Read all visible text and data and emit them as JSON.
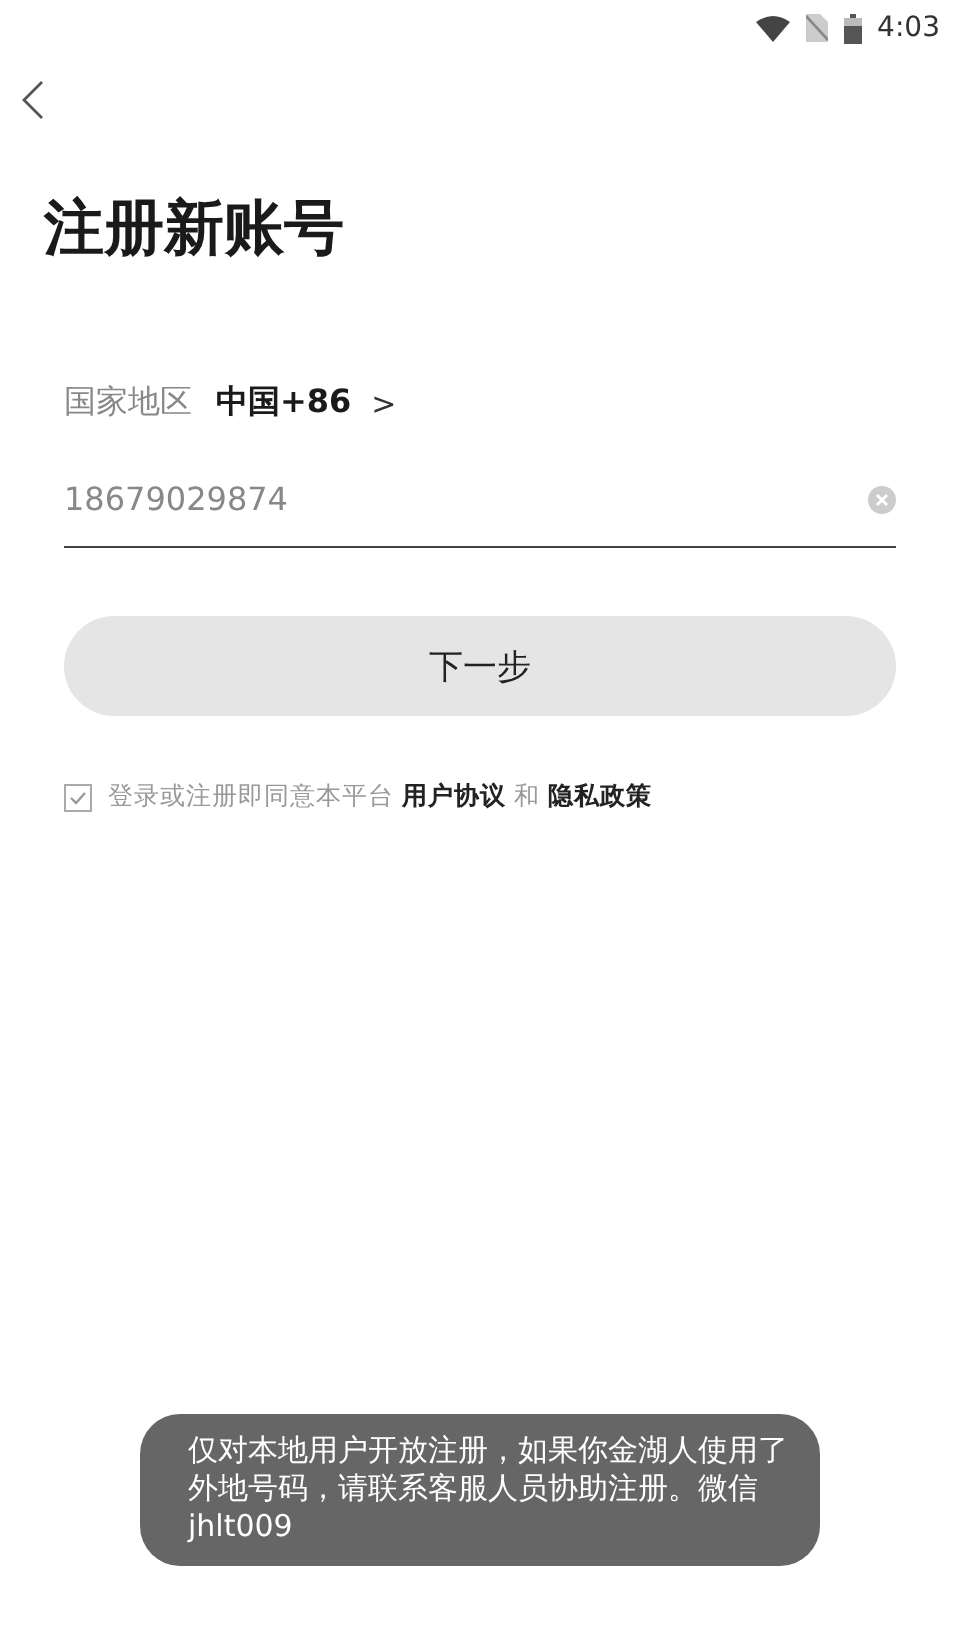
{
  "status_bar": {
    "time": "4:03"
  },
  "title": "注册新账号",
  "region": {
    "label": "国家地区",
    "value": "中国+86",
    "chevron": ">"
  },
  "phone": {
    "value": "18679029874"
  },
  "next_button": {
    "label": "下一步",
    "disabled": true
  },
  "agreement": {
    "checked": true,
    "text": "登录或注册即同意本平台",
    "user_agreement": "用户协议",
    "and": "和",
    "privacy_policy": "隐私政策"
  },
  "toast": "仅对本地用户开放注册，如果你金湖人使用了外地号码，请联系客服人员协助注册。微信 jhlt009"
}
